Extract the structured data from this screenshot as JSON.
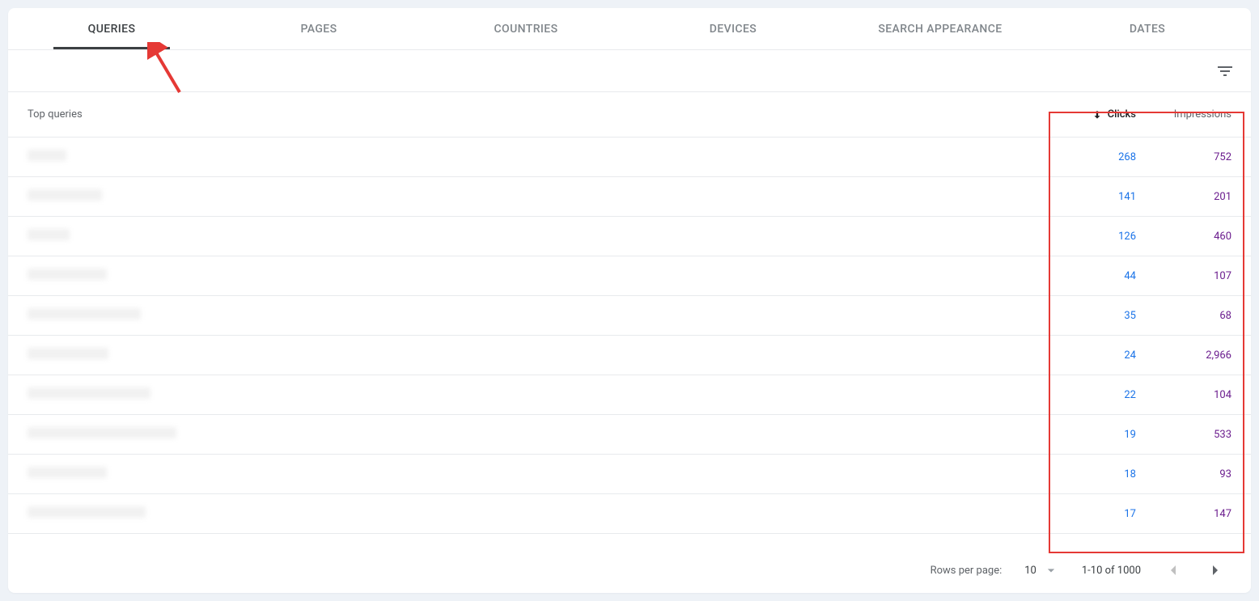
{
  "tabs": [
    {
      "label": "QUERIES",
      "active": true
    },
    {
      "label": "PAGES",
      "active": false
    },
    {
      "label": "COUNTRIES",
      "active": false
    },
    {
      "label": "DEVICES",
      "active": false
    },
    {
      "label": "SEARCH APPEARANCE",
      "active": false
    },
    {
      "label": "DATES",
      "active": false
    }
  ],
  "headers": {
    "query": "Top queries",
    "clicks": "Clicks",
    "impressions": "Impressions"
  },
  "rows": [
    {
      "qwidth": 48,
      "clicks": "268",
      "impressions": "752"
    },
    {
      "qwidth": 92,
      "clicks": "141",
      "impressions": "201"
    },
    {
      "qwidth": 52,
      "clicks": "126",
      "impressions": "460"
    },
    {
      "qwidth": 98,
      "clicks": "44",
      "impressions": "107"
    },
    {
      "qwidth": 140,
      "clicks": "35",
      "impressions": "68"
    },
    {
      "qwidth": 100,
      "clicks": "24",
      "impressions": "2,966"
    },
    {
      "qwidth": 152,
      "clicks": "22",
      "impressions": "104"
    },
    {
      "qwidth": 184,
      "clicks": "19",
      "impressions": "533"
    },
    {
      "qwidth": 98,
      "clicks": "18",
      "impressions": "93"
    },
    {
      "qwidth": 146,
      "clicks": "17",
      "impressions": "147"
    }
  ],
  "pagination": {
    "rows_label": "Rows per page:",
    "rows_value": "10",
    "range": "1-10 of 1000"
  }
}
